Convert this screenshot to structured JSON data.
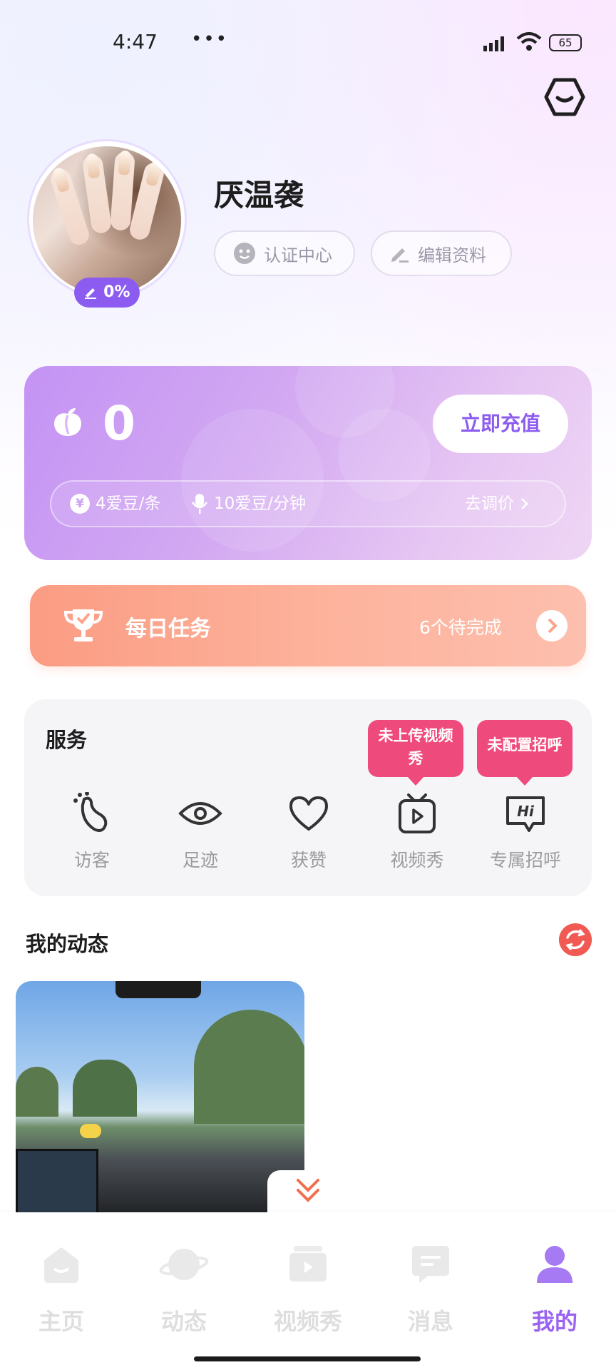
{
  "status_bar": {
    "time": "4:47",
    "dots": "•••",
    "battery": "65"
  },
  "profile": {
    "nickname": "厌温袭",
    "edit_progress": "0%",
    "cert_label": "认证中心",
    "edit_label": "编辑资料"
  },
  "wallet": {
    "balance": "0",
    "recharge_label": "立即充值",
    "price_message": "4爱豆/条",
    "price_voice": "10爱豆/分钟",
    "adjust_label": "去调价",
    "yen_symbol": "¥"
  },
  "daily_task": {
    "title": "每日任务",
    "pending": "6个待完成"
  },
  "services": {
    "title": "服务",
    "tooltip_video": "未上传视频秀",
    "tooltip_greet": "未配置招呼",
    "items": [
      {
        "label": "访客",
        "icon": "footprint-icon"
      },
      {
        "label": "足迹",
        "icon": "eye-icon"
      },
      {
        "label": "获赞",
        "icon": "heart-icon"
      },
      {
        "label": "视频秀",
        "icon": "tv-play-icon"
      },
      {
        "label": "专属招呼",
        "icon": "hi-chat-icon"
      }
    ]
  },
  "moments": {
    "title": "我的动态"
  },
  "tabbar": {
    "items": [
      {
        "label": "主页",
        "icon": "home-icon",
        "active": false
      },
      {
        "label": "动态",
        "icon": "planet-icon",
        "active": false
      },
      {
        "label": "视频秀",
        "icon": "video-icon",
        "active": false
      },
      {
        "label": "消息",
        "icon": "message-icon",
        "active": false
      },
      {
        "label": "我的",
        "icon": "person-icon",
        "active": true
      }
    ]
  },
  "colors": {
    "accent": "#8c5cf0",
    "task": "#fb9c83",
    "tooltip": "#ef4a7c",
    "refresh": "#f05a53"
  }
}
